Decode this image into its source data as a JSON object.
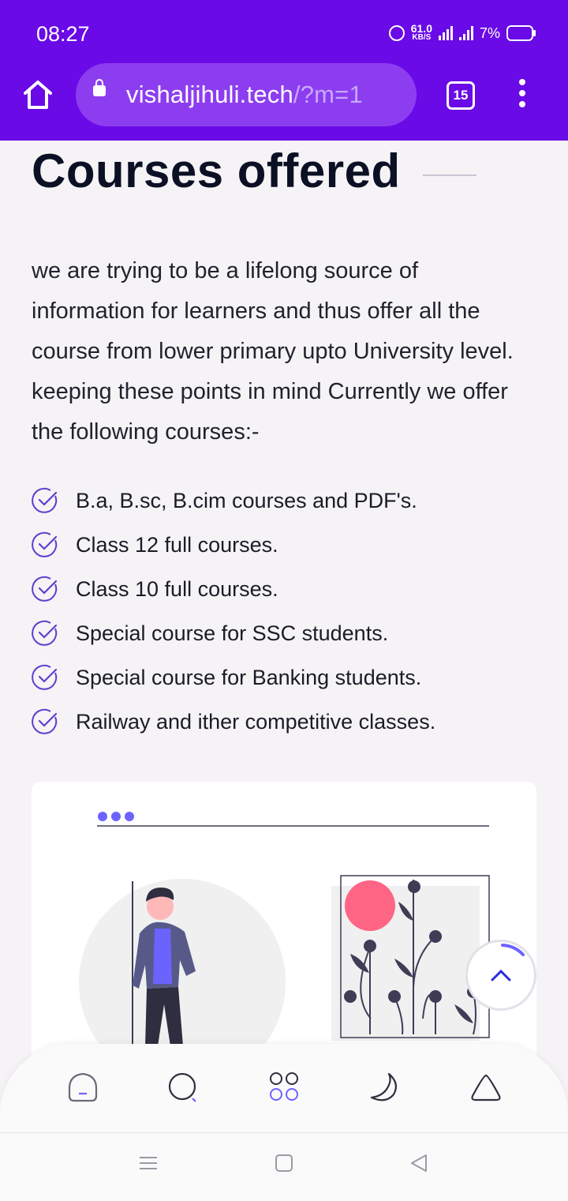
{
  "status_bar": {
    "time": "08:27",
    "network_speed": "61.0",
    "network_unit": "KB/S",
    "battery": "7%"
  },
  "browser": {
    "url_host": "vishaljihuli.tech",
    "url_path": "/?m=1",
    "tab_count": "15"
  },
  "page": {
    "title": "Courses offered",
    "intro": "we are trying to be a lifelong source of information for learners and thus offer all the course from lower primary upto University level. keeping these points in mind Currently we offer the following courses:-",
    "courses": [
      "B.a, B.sc, B.cim courses and PDF's.",
      "Class 12 full courses.",
      "Class 10 full courses.",
      "Special course for SSC students.",
      "Special course for Banking students.",
      "Railway and ither competitive classes."
    ]
  },
  "colors": {
    "brand": "#6a0ae6",
    "accent": "#6c63ff",
    "check": "#5b3fd0"
  },
  "icons": {
    "home": "home-icon",
    "lock": "lock-icon",
    "tabs": "tabs-icon",
    "menu": "more-vert-icon",
    "check": "check-circle-icon",
    "scroll_top": "chevron-up-icon",
    "bottom_nav": [
      "home-icon",
      "search-icon",
      "apps-icon",
      "moon-icon",
      "triangle-icon"
    ]
  }
}
